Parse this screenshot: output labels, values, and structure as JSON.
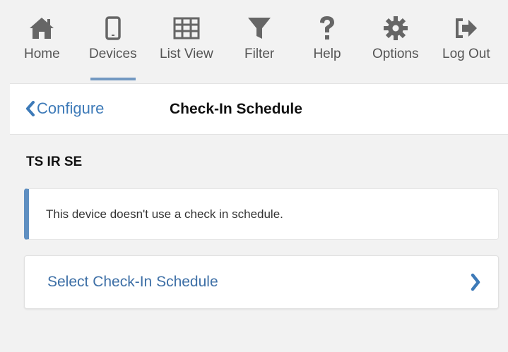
{
  "nav": {
    "items": [
      {
        "label": "Home",
        "icon": "home-icon"
      },
      {
        "label": "Devices",
        "icon": "mobile-device-icon",
        "active": true
      },
      {
        "label": "List View",
        "icon": "grid-icon"
      },
      {
        "label": "Filter",
        "icon": "filter-icon"
      },
      {
        "label": "Help",
        "icon": "question-icon"
      },
      {
        "label": "Options",
        "icon": "gear-icon"
      },
      {
        "label": "Log Out",
        "icon": "logout-icon"
      }
    ]
  },
  "header": {
    "back_label": "Configure",
    "title": "Check-In Schedule"
  },
  "device": {
    "name": "TS IR SE"
  },
  "notice": {
    "text": "This device doesn't use a check in schedule."
  },
  "action": {
    "label": "Select Check-In Schedule"
  },
  "colors": {
    "accent": "#3d7ab8",
    "icon": "#666666",
    "active_underline": "#7399c2",
    "notice_border": "#5f8fc1"
  }
}
